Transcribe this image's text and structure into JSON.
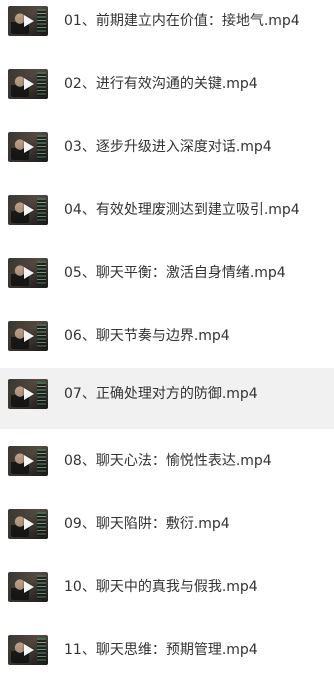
{
  "files": [
    {
      "name": "01、前期建立内在价值：接地气.mp4",
      "icon": "video-thumbnail-icon"
    },
    {
      "name": "02、进行有效沟通的关键.mp4",
      "icon": "video-thumbnail-icon"
    },
    {
      "name": "03、逐步升级进入深度对话.mp4",
      "icon": "video-thumbnail-icon"
    },
    {
      "name": "04、有效处理废测达到建立吸引.mp4",
      "icon": "video-thumbnail-icon"
    },
    {
      "name": "05、聊天平衡：激活自身情绪.mp4",
      "icon": "video-thumbnail-icon"
    },
    {
      "name": "06、聊天节奏与边界.mp4",
      "icon": "video-thumbnail-icon"
    },
    {
      "name": "07、正确处理对方的防御.mp4",
      "icon": "video-thumbnail-icon",
      "selected": true
    },
    {
      "name": "08、聊天心法：愉悦性表达.mp4",
      "icon": "video-thumbnail-icon"
    },
    {
      "name": "09、聊天陷阱：敷衍.mp4",
      "icon": "video-thumbnail-icon"
    },
    {
      "name": "10、聊天中的真我与假我.mp4",
      "icon": "video-thumbnail-icon"
    },
    {
      "name": "11、聊天思维：预期管理.mp4",
      "icon": "video-thumbnail-icon"
    }
  ],
  "colors": {
    "text": "#333333",
    "selected_background": "#f1f1f1"
  }
}
